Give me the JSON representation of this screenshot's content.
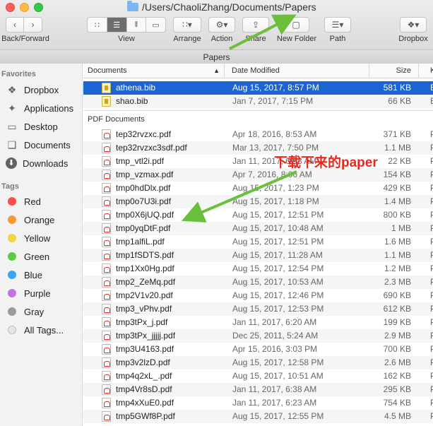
{
  "window": {
    "title": "/Users/ChaoliZhang/Documents/Papers",
    "path_title": "Papers"
  },
  "toolbar": {
    "back_forward_label": "Back/Forward",
    "view_label": "View",
    "arrange_label": "Arrange",
    "action_label": "Action",
    "share_label": "Share",
    "new_folder_label": "New Folder",
    "path_label": "Path",
    "dropbox_label": "Dropbox"
  },
  "sidebar": {
    "favorites_header": "Favorites",
    "favorites": [
      {
        "label": "Dropbox",
        "icon": "dropbox-icon"
      },
      {
        "label": "Applications",
        "icon": "applications-icon"
      },
      {
        "label": "Desktop",
        "icon": "desktop-icon"
      },
      {
        "label": "Documents",
        "icon": "documents-icon"
      },
      {
        "label": "Downloads",
        "icon": "downloads-icon"
      }
    ],
    "tags_header": "Tags",
    "tags": [
      {
        "label": "Red",
        "color": "#fc4c4c"
      },
      {
        "label": "Orange",
        "color": "#f79a32"
      },
      {
        "label": "Yellow",
        "color": "#f5d33c"
      },
      {
        "label": "Green",
        "color": "#5ecb44"
      },
      {
        "label": "Blue",
        "color": "#3da5f5"
      },
      {
        "label": "Purple",
        "color": "#c373e0"
      },
      {
        "label": "Gray",
        "color": "#9a9a9a"
      },
      {
        "label": "All Tags...",
        "color": "#e6e6e6"
      }
    ]
  },
  "columns": {
    "name": "Documents",
    "date": "Date Modified",
    "size": "Size",
    "kind": "K"
  },
  "documents": [
    {
      "name": "athena.bib",
      "date": "Aug 15, 2017, 8:57 PM",
      "size": "581 KB",
      "kind": "B",
      "selected": true
    },
    {
      "name": "shao.bib",
      "date": "Jan 7, 2017, 7:15 PM",
      "size": "66 KB",
      "kind": "B",
      "selected": false
    }
  ],
  "pdf_group_label": "PDF Documents",
  "pdfs": [
    {
      "name": "tep32rvzxc.pdf",
      "date": "Apr 18, 2016, 8:53 AM",
      "size": "371 KB",
      "kind": "P"
    },
    {
      "name": "tep32rvzxc3sdf.pdf",
      "date": "Mar 13, 2017, 7:50 PM",
      "size": "1.1 MB",
      "kind": "P"
    },
    {
      "name": "tmp_vtl2i.pdf",
      "date": "Jan 11, 2017, 6:53 AM",
      "size": "22 KB",
      "kind": "P"
    },
    {
      "name": "tmp_vzmax.pdf",
      "date": "Apr 7, 2016, 8:06 AM",
      "size": "154 KB",
      "kind": "P"
    },
    {
      "name": "tmp0hdDlx.pdf",
      "date": "Aug 15, 2017, 1:23 PM",
      "size": "429 KB",
      "kind": "P"
    },
    {
      "name": "tmp0o7U3i.pdf",
      "date": "Aug 15, 2017, 1:18 PM",
      "size": "1.4 MB",
      "kind": "P"
    },
    {
      "name": "tmp0X6jUQ.pdf",
      "date": "Aug 15, 2017, 12:51 PM",
      "size": "800 KB",
      "kind": "P"
    },
    {
      "name": "tmp0yqDtF.pdf",
      "date": "Aug 15, 2017, 10:48 AM",
      "size": "1 MB",
      "kind": "P"
    },
    {
      "name": "tmp1alfiL.pdf",
      "date": "Aug 15, 2017, 12:51 PM",
      "size": "1.6 MB",
      "kind": "P"
    },
    {
      "name": "tmp1fSDTS.pdf",
      "date": "Aug 15, 2017, 11:28 AM",
      "size": "1.1 MB",
      "kind": "P"
    },
    {
      "name": "tmp1Xx0Hg.pdf",
      "date": "Aug 15, 2017, 12:54 PM",
      "size": "1.2 MB",
      "kind": "P"
    },
    {
      "name": "tmp2_ZeMq.pdf",
      "date": "Aug 15, 2017, 10:53 AM",
      "size": "2.3 MB",
      "kind": "P"
    },
    {
      "name": "tmp2V1v20.pdf",
      "date": "Aug 15, 2017, 12:46 PM",
      "size": "690 KB",
      "kind": "P"
    },
    {
      "name": "tmp3_vPhv.pdf",
      "date": "Aug 15, 2017, 12:53 PM",
      "size": "612 KB",
      "kind": "P"
    },
    {
      "name": "tmp3tPx_j.pdf",
      "date": "Jan 11, 2017, 6:20 AM",
      "size": "199 KB",
      "kind": "P"
    },
    {
      "name": "tmp3tPx_jjjjj.pdf",
      "date": "Dec 25, 2011, 5:24 AM",
      "size": "2.9 MB",
      "kind": "P"
    },
    {
      "name": "tmp3U4163.pdf",
      "date": "Apr 15, 2016, 3:03 PM",
      "size": "700 KB",
      "kind": "P"
    },
    {
      "name": "tmp3v2lzD.pdf",
      "date": "Aug 15, 2017, 12:58 PM",
      "size": "2.6 MB",
      "kind": "P"
    },
    {
      "name": "tmp4q2xL_.pdf",
      "date": "Aug 15, 2017, 10:51 AM",
      "size": "162 KB",
      "kind": "P"
    },
    {
      "name": "tmp4Vr8sD.pdf",
      "date": "Jan 11, 2017, 6:38 AM",
      "size": "295 KB",
      "kind": "P"
    },
    {
      "name": "tmp4xXuE0.pdf",
      "date": "Jan 11, 2017, 6:23 AM",
      "size": "754 KB",
      "kind": "P"
    },
    {
      "name": "tmp5GWf8P.pdf",
      "date": "Aug 15, 2017, 12:55 PM",
      "size": "4.5 MB",
      "kind": "P"
    }
  ],
  "annotation": {
    "text": "下载下来的paper",
    "color": "#e8281e",
    "arrow_color": "#6cbf3b"
  }
}
